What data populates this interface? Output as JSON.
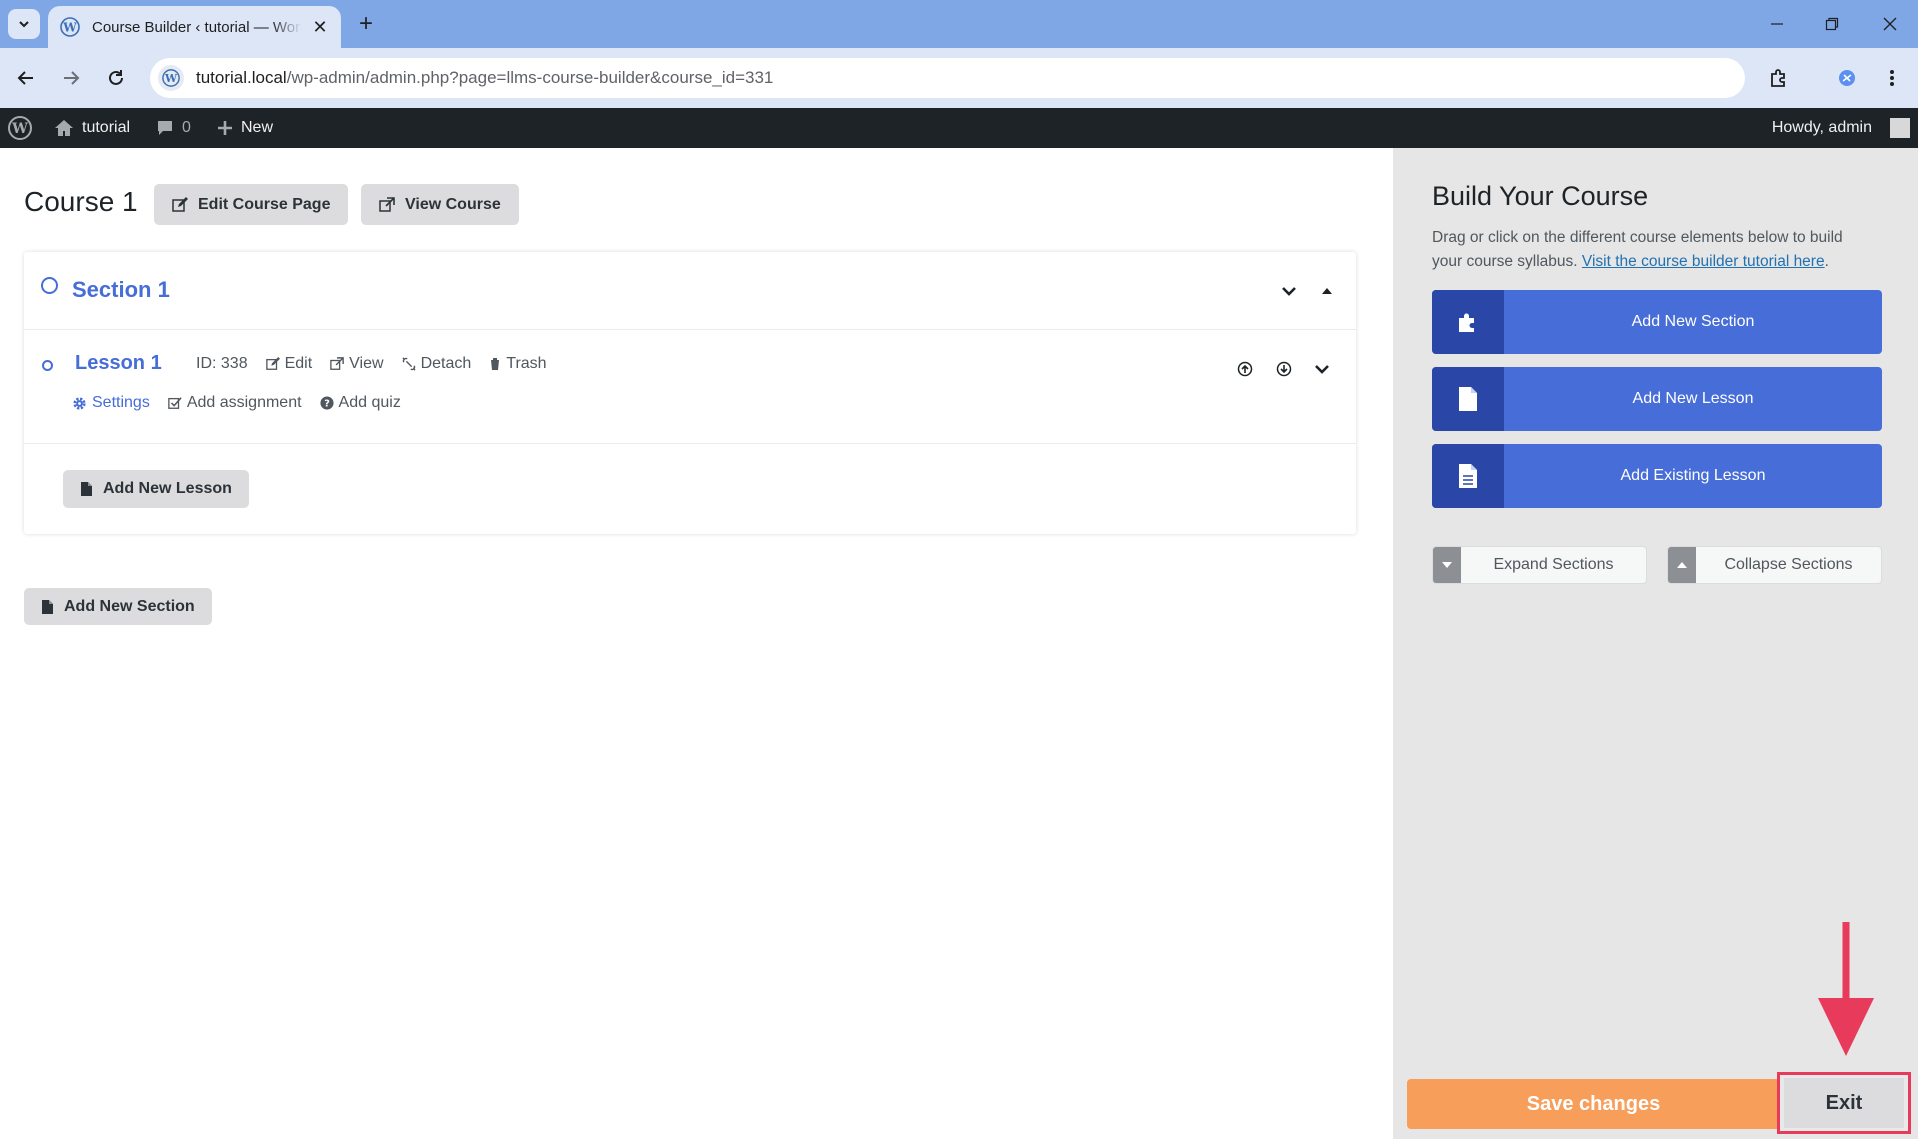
{
  "browser": {
    "tab_title": "Course Builder ‹ tutorial — WordPress",
    "url_host": "tutorial.local",
    "url_path": "/wp-admin/admin.php?page=llms-course-builder&course_id=331"
  },
  "admin_bar": {
    "site_name": "tutorial",
    "comments_count": "0",
    "new_label": "New",
    "greeting": "Howdy, admin"
  },
  "course": {
    "title": "Course 1",
    "edit_page_label": "Edit Course Page",
    "view_course_label": "View Course",
    "section": {
      "title": "Section 1",
      "lesson": {
        "title": "Lesson 1",
        "id_label": "ID: 338",
        "edit_label": "Edit",
        "view_label": "View",
        "detach_label": "Detach",
        "trash_label": "Trash",
        "settings_label": "Settings",
        "add_assignment_label": "Add assignment",
        "add_quiz_label": "Add quiz"
      },
      "add_lesson_label": "Add New Lesson"
    },
    "add_section_label": "Add New Section"
  },
  "panel": {
    "title": "Build Your Course",
    "description": "Drag or click on the different course elements below to build your course syllabus.",
    "tutorial_link": "Visit the course builder tutorial here",
    "add_section": "Add New Section",
    "add_lesson": "Add New Lesson",
    "add_existing_lesson": "Add Existing Lesson",
    "expand_sections": "Expand Sections",
    "collapse_sections": "Collapse Sections"
  },
  "footer": {
    "save_label": "Save changes",
    "exit_label": "Exit"
  },
  "colors": {
    "accent_blue": "#466dd8",
    "save_orange": "#f79e5a",
    "annotation_red": "#e83a5a",
    "admin_bar_bg": "#1d2327"
  }
}
